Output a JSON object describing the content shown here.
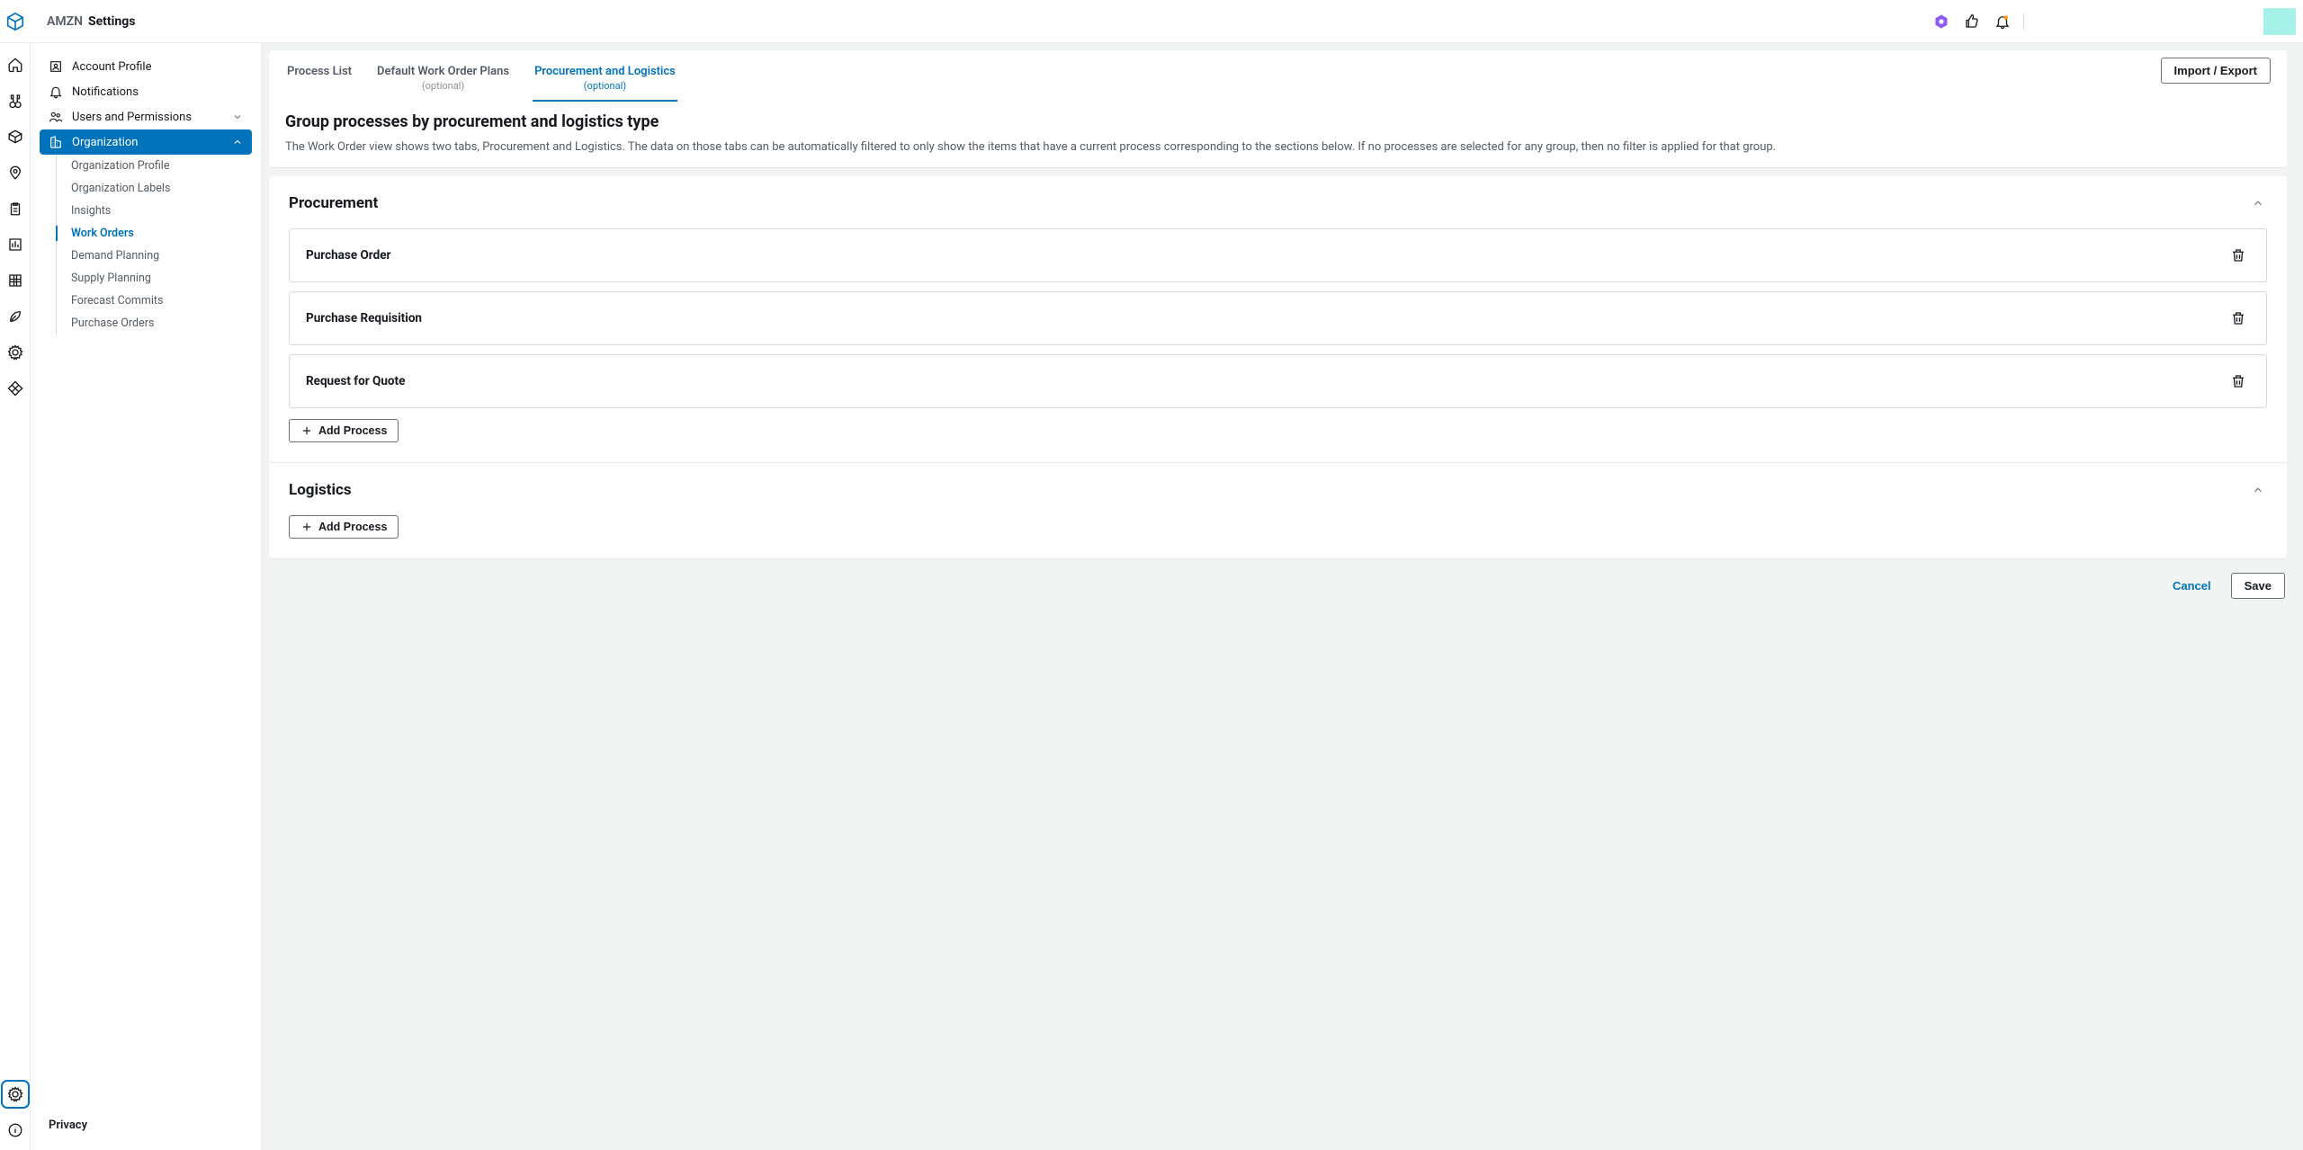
{
  "header": {
    "org": "AMZN",
    "page_title": "Settings"
  },
  "sidebar": {
    "items": [
      {
        "label": "Account Profile"
      },
      {
        "label": "Notifications"
      },
      {
        "label": "Users and Permissions",
        "expandable": true
      },
      {
        "label": "Organization",
        "expandable": true,
        "selected": true,
        "children": [
          {
            "label": "Organization Profile"
          },
          {
            "label": "Organization Labels"
          },
          {
            "label": "Insights"
          },
          {
            "label": "Work Orders",
            "active": true
          },
          {
            "label": "Demand Planning"
          },
          {
            "label": "Supply Planning"
          },
          {
            "label": "Forecast Commits"
          },
          {
            "label": "Purchase Orders"
          }
        ]
      }
    ],
    "privacy_label": "Privacy"
  },
  "tabs": [
    {
      "label": "Process List"
    },
    {
      "label": "Default Work Order Plans",
      "sub": "(optional)"
    },
    {
      "label": "Procurement and Logistics",
      "sub": "(optional)",
      "active": true
    }
  ],
  "import_export_label": "Import / Export",
  "page": {
    "title": "Group processes by procurement and logistics type",
    "description": "The Work Order view shows two tabs, Procurement and Logistics. The data on those tabs can be automatically filtered to only show the items that have a current process corresponding to the sections below. If no processes are selected for any group, then no filter is applied for that group."
  },
  "groups": {
    "procurement": {
      "title": "Procurement",
      "items": [
        {
          "name": "Purchase Order"
        },
        {
          "name": "Purchase Requisition"
        },
        {
          "name": "Request for Quote"
        }
      ],
      "add_label": "Add Process"
    },
    "logistics": {
      "title": "Logistics",
      "items": [],
      "add_label": "Add Process"
    }
  },
  "actions": {
    "cancel": "Cancel",
    "save": "Save"
  }
}
